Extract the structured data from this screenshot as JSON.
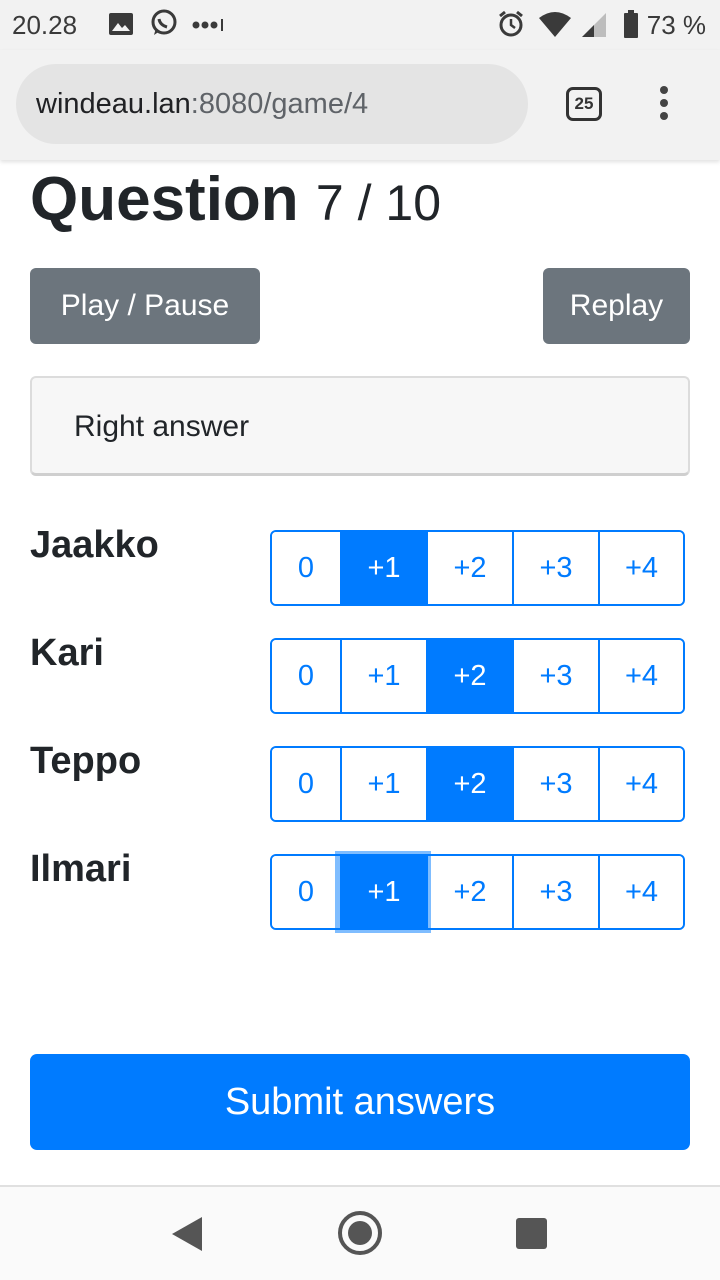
{
  "status_bar": {
    "time": "20.28",
    "battery_percent": "73 %",
    "icons": [
      "image-icon",
      "whatsapp-icon",
      "more-notifications-icon",
      "alarm-icon",
      "wifi-icon",
      "signal-icon",
      "battery-icon"
    ]
  },
  "browser": {
    "url_host": "windeau.lan",
    "url_rest": ":8080/game/4",
    "tab_count": "25",
    "icons": [
      "tab-switcher-icon",
      "menu-dots-icon"
    ]
  },
  "question": {
    "label": "Question",
    "counter": "7 / 10"
  },
  "controls": {
    "play_label": "Play / Pause",
    "replay_label": "Replay"
  },
  "answer": {
    "text": "Right answer"
  },
  "score_options": [
    "0",
    "+1",
    "+2",
    "+3",
    "+4"
  ],
  "players": [
    {
      "name": "Jaakko",
      "selected": 1,
      "focused": false
    },
    {
      "name": "Kari",
      "selected": 2,
      "focused": false
    },
    {
      "name": "Teppo",
      "selected": 2,
      "focused": false
    },
    {
      "name": "Ilmari",
      "selected": 1,
      "focused": true
    }
  ],
  "submit_label": "Submit answers",
  "colors": {
    "primary": "#007bff",
    "secondary": "#6c757d",
    "text": "#212529"
  },
  "nav_icons": [
    "back-icon",
    "home-icon",
    "recents-icon"
  ]
}
